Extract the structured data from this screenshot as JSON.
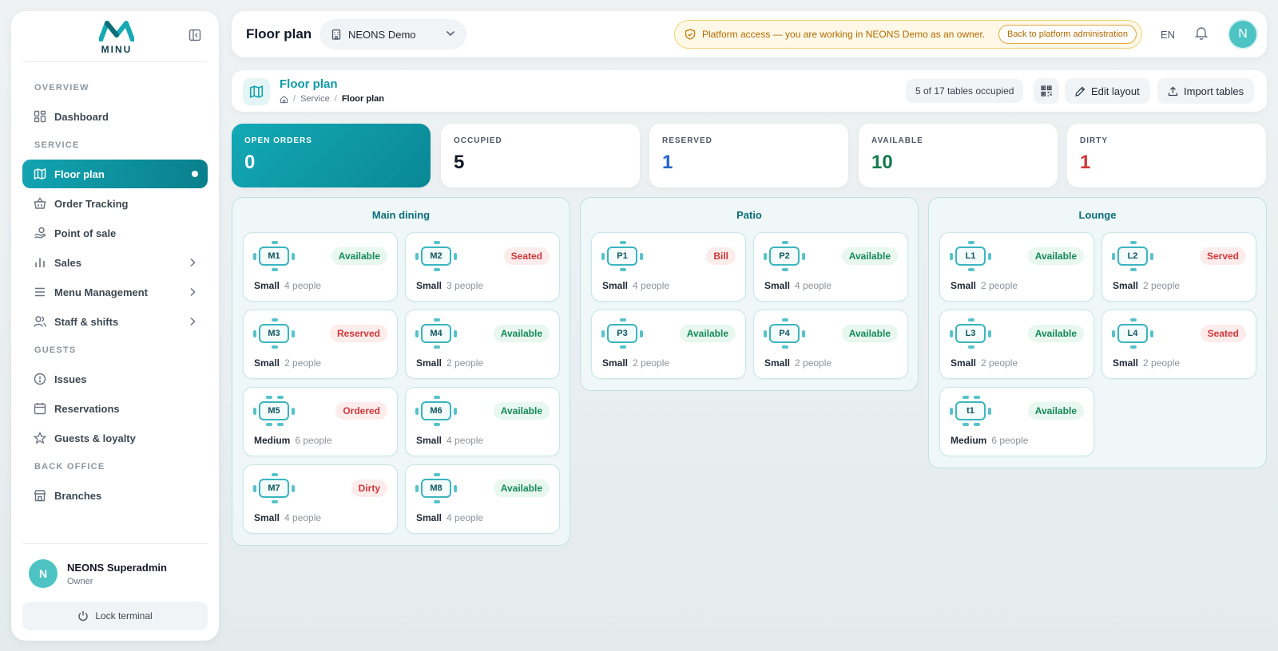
{
  "sidebar": {
    "logo_text": "MINU",
    "sections": {
      "overview": "OVERVIEW",
      "service": "SERVICE",
      "guests": "GUESTS",
      "back_office": "BACK OFFICE"
    },
    "items": {
      "dashboard": "Dashboard",
      "floor_plan": "Floor plan",
      "order_tracking": "Order Tracking",
      "point_of_sale": "Point of sale",
      "sales": "Sales",
      "menu_management": "Menu Management",
      "staff_shifts": "Staff & shifts",
      "issues": "Issues",
      "reservations": "Reservations",
      "guests_loyalty": "Guests & loyalty",
      "branches": "Branches"
    },
    "user": {
      "initial": "N",
      "name": "NEONS Superadmin",
      "role": "Owner"
    },
    "lock_label": "Lock terminal"
  },
  "topbar": {
    "title": "Floor plan",
    "branch": "NEONS Demo",
    "alert_text": "Platform access — you are working in NEONS Demo as an owner.",
    "alert_button": "Back to platform administration",
    "language": "EN",
    "avatar_initial": "N"
  },
  "page_header": {
    "title": "Floor plan",
    "breadcrumb_service": "Service",
    "breadcrumb_current": "Floor plan",
    "occupancy": "5 of 17 tables occupied",
    "edit_layout": "Edit layout",
    "import_tables": "Import tables"
  },
  "stats": [
    {
      "label": "OPEN ORDERS",
      "value": "0",
      "color": "#ffffff"
    },
    {
      "label": "OCCUPIED",
      "value": "5",
      "color": "#111827"
    },
    {
      "label": "RESERVED",
      "value": "1",
      "color": "#2563c9"
    },
    {
      "label": "AVAILABLE",
      "value": "10",
      "color": "#137a4e"
    },
    {
      "label": "DIRTY",
      "value": "1",
      "color": "#d0383a"
    }
  ],
  "zones": [
    {
      "name": "Main dining",
      "tables": [
        {
          "id": "M1",
          "status": "Available",
          "size": "Small",
          "people": "4 people"
        },
        {
          "id": "M2",
          "status": "Seated",
          "size": "Small",
          "people": "3 people"
        },
        {
          "id": "M3",
          "status": "Reserved",
          "size": "Small",
          "people": "2 people"
        },
        {
          "id": "M4",
          "status": "Available",
          "size": "Small",
          "people": "2 people"
        },
        {
          "id": "M5",
          "status": "Ordered",
          "size": "Medium",
          "people": "6 people"
        },
        {
          "id": "M6",
          "status": "Available",
          "size": "Small",
          "people": "4 people"
        },
        {
          "id": "M7",
          "status": "Dirty",
          "size": "Small",
          "people": "4 people"
        },
        {
          "id": "M8",
          "status": "Available",
          "size": "Small",
          "people": "4 people"
        }
      ]
    },
    {
      "name": "Patio",
      "tables": [
        {
          "id": "P1",
          "status": "Bill",
          "size": "Small",
          "people": "4 people"
        },
        {
          "id": "P2",
          "status": "Available",
          "size": "Small",
          "people": "4 people"
        },
        {
          "id": "P3",
          "status": "Available",
          "size": "Small",
          "people": "2 people"
        },
        {
          "id": "P4",
          "status": "Available",
          "size": "Small",
          "people": "2 people"
        }
      ]
    },
    {
      "name": "Lounge",
      "tables": [
        {
          "id": "L1",
          "status": "Available",
          "size": "Small",
          "people": "2 people"
        },
        {
          "id": "L2",
          "status": "Served",
          "size": "Small",
          "people": "2 people"
        },
        {
          "id": "L3",
          "status": "Available",
          "size": "Small",
          "people": "2 people"
        },
        {
          "id": "L4",
          "status": "Seated",
          "size": "Small",
          "people": "2 people"
        },
        {
          "id": "t1",
          "status": "Available",
          "size": "Medium",
          "people": "6 people"
        }
      ]
    }
  ]
}
